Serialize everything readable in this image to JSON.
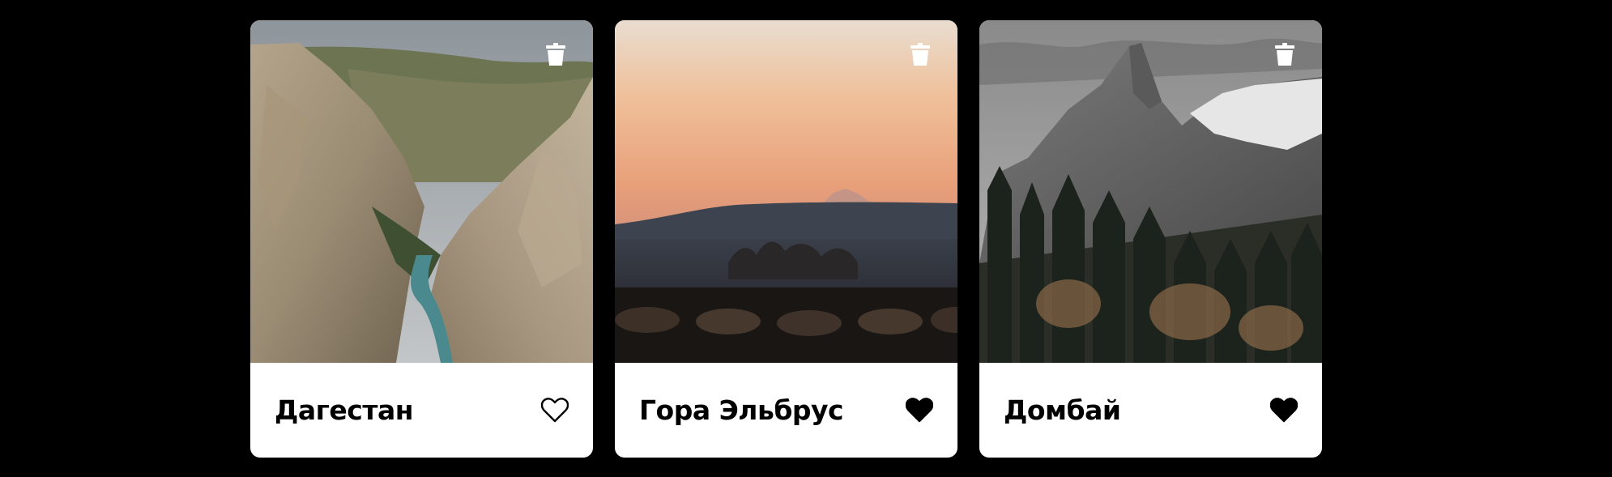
{
  "cards": [
    {
      "title": "Дагестан",
      "liked": false,
      "image_icon": "canyon-photo",
      "delete_icon": "trash-icon",
      "like_icon": "heart-outline-icon"
    },
    {
      "title": "Гора Эльбрус",
      "liked": true,
      "image_icon": "sunset-mountain-photo",
      "delete_icon": "trash-icon",
      "like_icon": "heart-filled-icon"
    },
    {
      "title": "Домбай",
      "liked": true,
      "image_icon": "peak-forest-photo",
      "delete_icon": "trash-icon",
      "like_icon": "heart-filled-icon"
    }
  ],
  "colors": {
    "background": "#000000",
    "card": "#ffffff",
    "text": "#000000",
    "icon_overlay": "#ffffff"
  }
}
